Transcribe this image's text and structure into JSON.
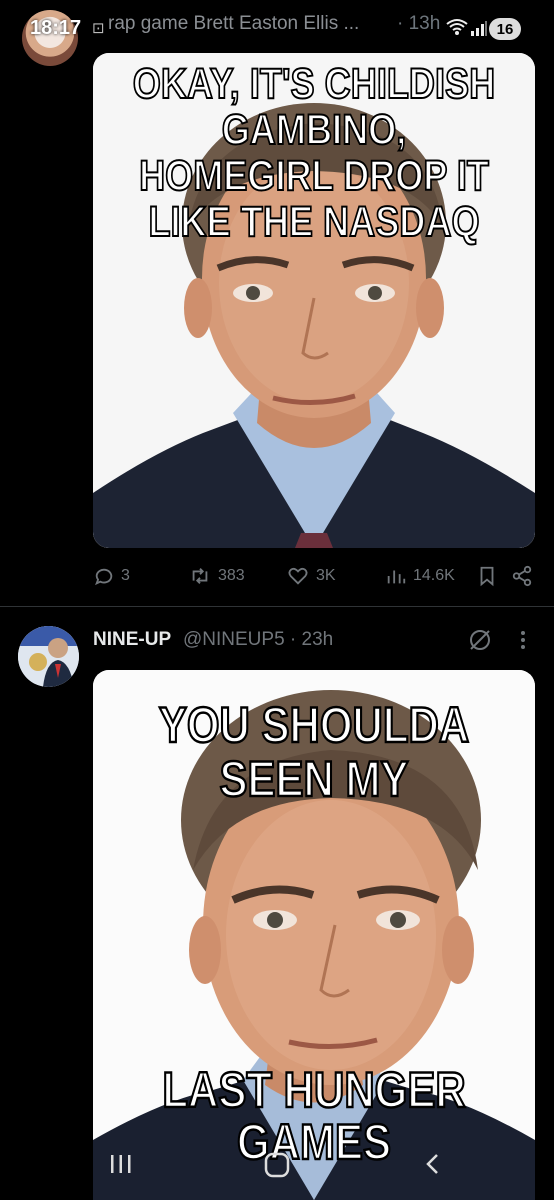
{
  "status_bar": {
    "time": "18:17",
    "battery": "16"
  },
  "tweet1": {
    "header_text": "rap game Brett Easton Ellis ...",
    "time": "· 13h",
    "meme_caption": "OKAY, IT'S CHILDISH GAMBINO, HOMEGIRL DROP IT LIKE THE NASDAQ",
    "actions": {
      "replies": "3",
      "reposts": "383",
      "likes": "3K",
      "views": "14.6K"
    }
  },
  "tweet2": {
    "display_name": "NINE-UP",
    "handle_time": "@NINEUP5 · 23h",
    "meme_caption_top": "YOU SHOULDA SEEN MY",
    "meme_caption_bottom": "LAST HUNGER GAMES"
  },
  "icons": {
    "reply": "speech-bubble-icon",
    "repost": "repost-arrows-icon",
    "like": "heart-icon",
    "views": "bar-chart-icon",
    "bookmark": "bookmark-icon",
    "share": "share-icon",
    "grok": "slash-circle-icon",
    "more": "vertical-ellipsis-icon"
  }
}
